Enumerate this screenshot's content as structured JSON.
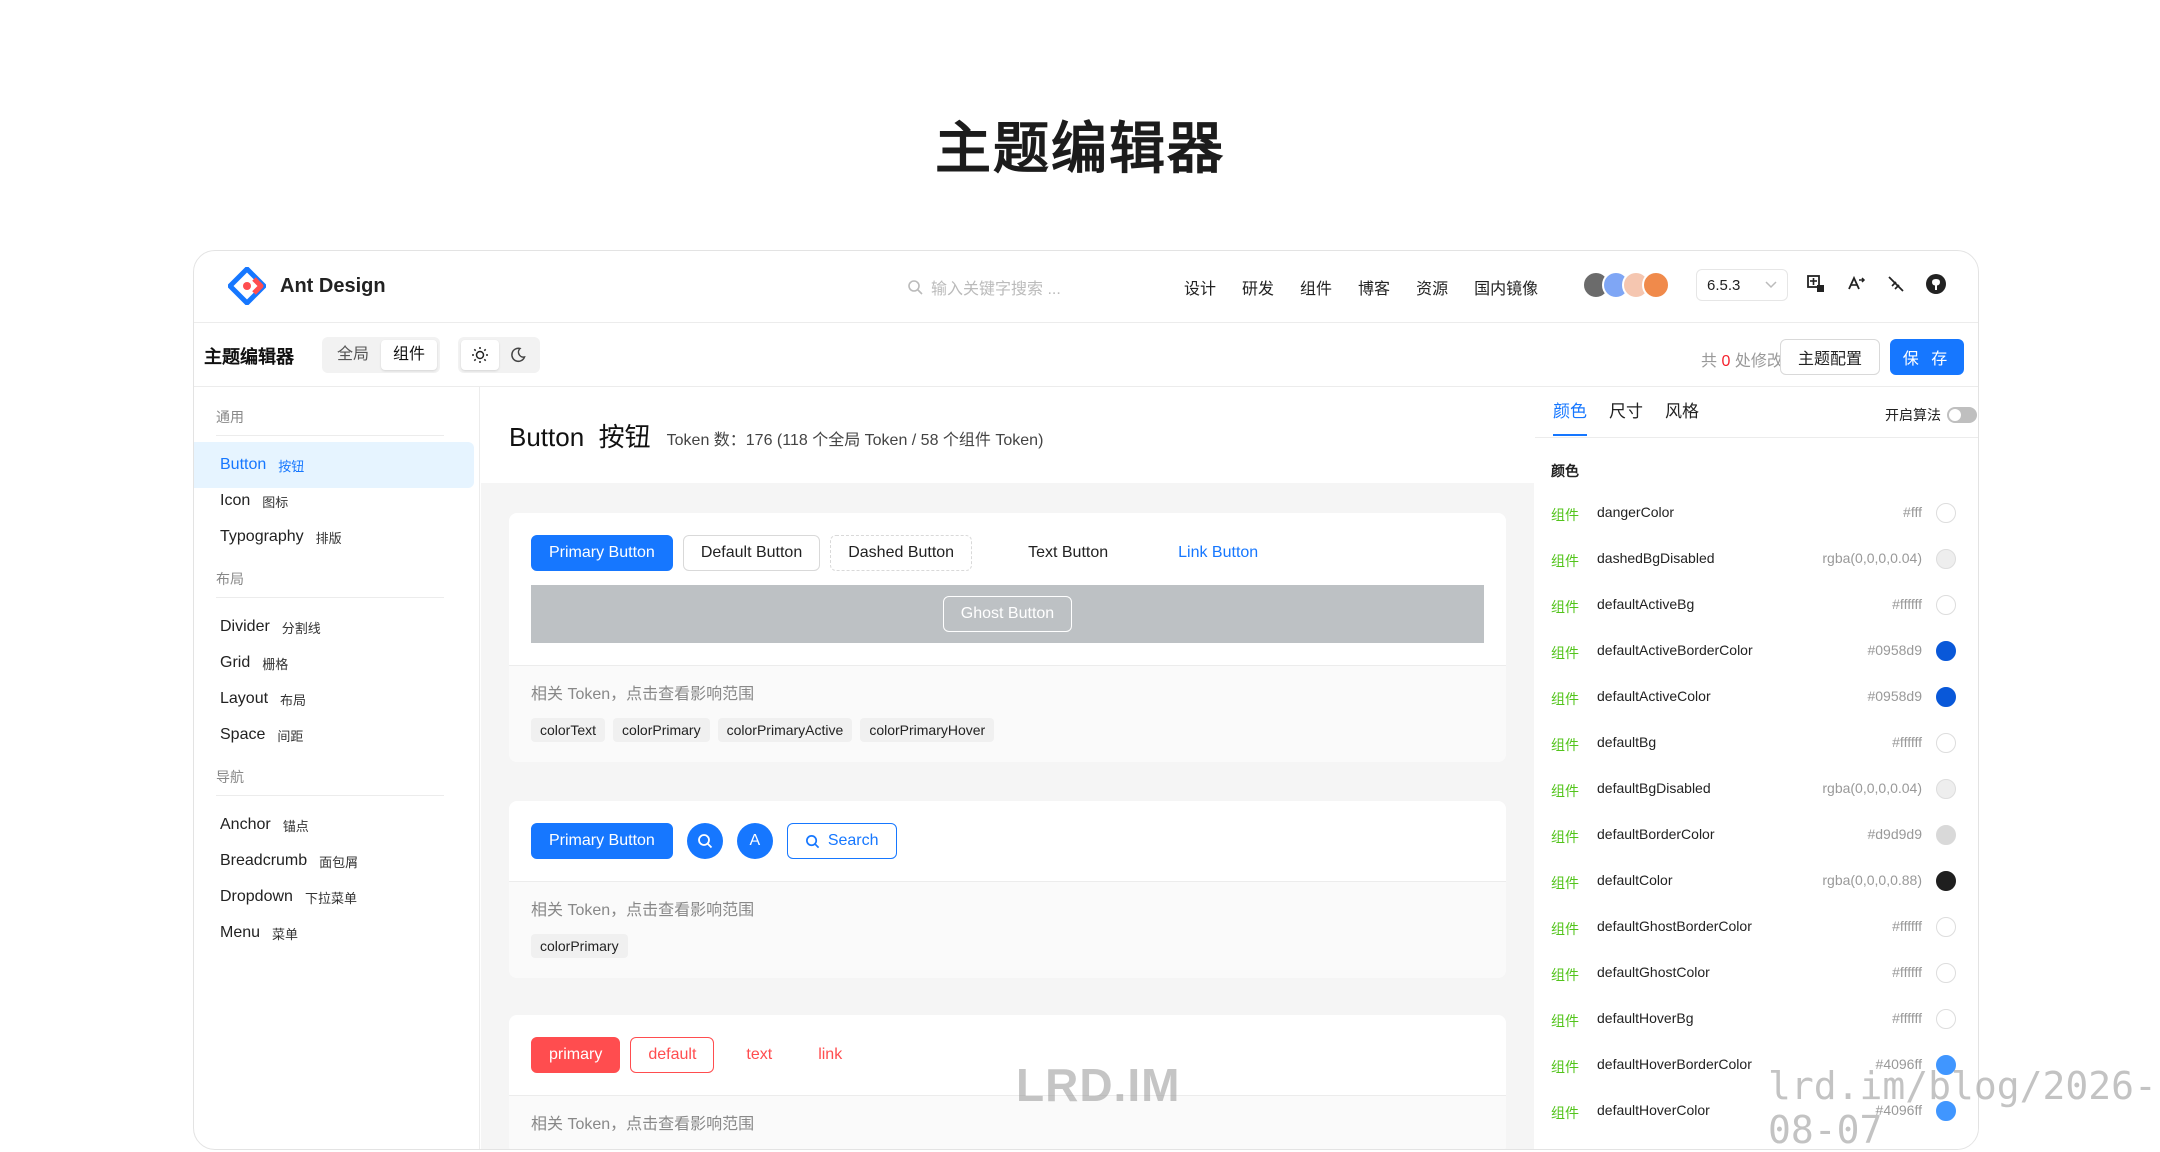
{
  "page_title": "主题编辑器",
  "header": {
    "logo_text": "Ant Design",
    "search_placeholder": "输入关键字搜索 ...",
    "nav": [
      "设计",
      "研发",
      "组件",
      "博客",
      "资源",
      "国内镜像"
    ],
    "version": "6.5.3"
  },
  "toolbar": {
    "title": "主题编辑器",
    "segments": [
      "全局",
      "组件"
    ],
    "active_segment": "组件",
    "mod_prefix": "共",
    "mod_count": "0",
    "mod_suffix": "处修改",
    "config_label": "主题配置",
    "save_label": "保 存"
  },
  "sidebar": {
    "groups": [
      {
        "label": "通用",
        "items": [
          {
            "en": "Button",
            "cn": "按钮",
            "active": true
          },
          {
            "en": "Icon",
            "cn": "图标"
          },
          {
            "en": "Typography",
            "cn": "排版"
          }
        ]
      },
      {
        "label": "布局",
        "items": [
          {
            "en": "Divider",
            "cn": "分割线"
          },
          {
            "en": "Grid",
            "cn": "栅格"
          },
          {
            "en": "Layout",
            "cn": "布局"
          },
          {
            "en": "Space",
            "cn": "间距"
          }
        ]
      },
      {
        "label": "导航",
        "items": [
          {
            "en": "Anchor",
            "cn": "锚点"
          },
          {
            "en": "Breadcrumb",
            "cn": "面包屑"
          },
          {
            "en": "Dropdown",
            "cn": "下拉菜单"
          },
          {
            "en": "Menu",
            "cn": "菜单"
          }
        ]
      }
    ]
  },
  "content": {
    "title_en": "Button",
    "title_cn": "按钮",
    "token_summary": "Token 数：176 (118 个全局 Token / 58 个组件 Token)",
    "token_label": "相关 Token，点击查看影响范围",
    "demo1": {
      "primary": "Primary Button",
      "default": "Default Button",
      "dashed": "Dashed Button",
      "text": "Text Button",
      "link": "Link Button",
      "ghost": "Ghost Button",
      "tokens": [
        "colorText",
        "colorPrimary",
        "colorPrimaryActive",
        "colorPrimaryHover"
      ]
    },
    "demo2": {
      "primary": "Primary Button",
      "circle_letter": "A",
      "search": "Search",
      "tokens": [
        "colorPrimary"
      ]
    },
    "demo3": {
      "primary": "primary",
      "default": "default",
      "text": "text",
      "link": "link"
    }
  },
  "right_panel": {
    "tabs": [
      "颜色",
      "尺寸",
      "风格"
    ],
    "active_tab": "颜色",
    "algorithm_label": "开启算法",
    "algorithm_enabled": false,
    "section_label": "颜色",
    "tag_label": "组件",
    "tokens": [
      {
        "name": "dangerColor",
        "value": "#fff",
        "swatch": "#ffffff"
      },
      {
        "name": "dashedBgDisabled",
        "value": "rgba(0,0,0,0.04)",
        "swatch": "#eeeeee"
      },
      {
        "name": "defaultActiveBg",
        "value": "#ffffff",
        "swatch": "#ffffff"
      },
      {
        "name": "defaultActiveBorderColor",
        "value": "#0958d9",
        "swatch": "#0958d9"
      },
      {
        "name": "defaultActiveColor",
        "value": "#0958d9",
        "swatch": "#0958d9"
      },
      {
        "name": "defaultBg",
        "value": "#ffffff",
        "swatch": "#ffffff"
      },
      {
        "name": "defaultBgDisabled",
        "value": "rgba(0,0,0,0.04)",
        "swatch": "#eeeeee"
      },
      {
        "name": "defaultBorderColor",
        "value": "#d9d9d9",
        "swatch": "#d9d9d9"
      },
      {
        "name": "defaultColor",
        "value": "rgba(0,0,0,0.88)",
        "swatch": "#1f1f1f"
      },
      {
        "name": "defaultGhostBorderColor",
        "value": "#ffffff",
        "swatch": "#ffffff"
      },
      {
        "name": "defaultGhostColor",
        "value": "#ffffff",
        "swatch": "#ffffff"
      },
      {
        "name": "defaultHoverBg",
        "value": "#ffffff",
        "swatch": "#ffffff"
      },
      {
        "name": "defaultHoverBorderColor",
        "value": "#4096ff",
        "swatch": "#4096ff"
      },
      {
        "name": "defaultHoverColor",
        "value": "#4096ff",
        "swatch": "#4096ff"
      }
    ]
  },
  "watermark_left": "LRD.IM",
  "watermark_right": "lrd.im/blog/2026-08-07",
  "colors": {
    "primary": "#1677ff",
    "danger": "#ff4d4f",
    "tag_green": "#52c41a"
  }
}
